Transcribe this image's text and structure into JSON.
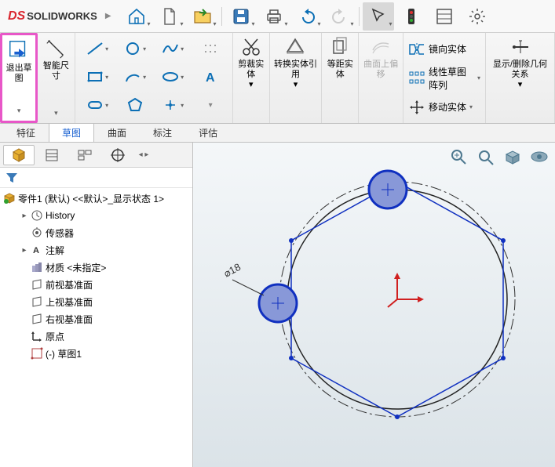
{
  "app": {
    "brand_ds": "DS",
    "brand_solid": "SOLID",
    "brand_works": "WORKS"
  },
  "ribbon": {
    "exit_sketch": "退出草图",
    "smart_dim": "智能尺寸",
    "trim": "剪裁实体",
    "convert": "转换实体引用",
    "offset": "等距实体",
    "on_surface": "曲面上偏移",
    "mirror": "镜向实体",
    "linear_pattern": "线性草图阵列",
    "move": "移动实体",
    "show_hide": "显示/删除几何关系"
  },
  "tabs": [
    "特征",
    "草图",
    "曲面",
    "标注",
    "评估"
  ],
  "active_tab_index": 1,
  "tree": {
    "root": "零件1 (默认) <<默认>_显示状态 1>",
    "history": "History",
    "sensors": "传感器",
    "annotations": "注解",
    "material": "材质 <未指定>",
    "front": "前视基准面",
    "top": "上视基准面",
    "right": "右视基准面",
    "origin": "原点",
    "sketch1": "(-) 草图1"
  },
  "dimension_label": "⌀18"
}
